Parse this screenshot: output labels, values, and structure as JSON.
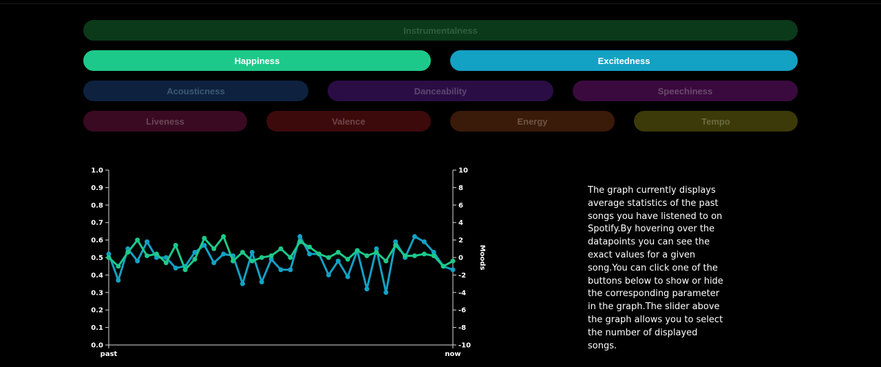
{
  "buttons": {
    "instrumentalness": {
      "label": "Instrumentalness",
      "bg": "#0a3a1a",
      "fg": "#2f5f3d"
    },
    "happiness": {
      "label": "Happiness",
      "bg": "#1dc98a",
      "fg": "#ffffff"
    },
    "excitedness": {
      "label": "Excitedness",
      "bg": "#13a1c4",
      "fg": "#ffffff"
    },
    "acousticness": {
      "label": "Acousticness",
      "bg": "#0e2240",
      "fg": "#3d5772"
    },
    "danceability": {
      "label": "Danceability",
      "bg": "#2a0d44",
      "fg": "#5c4873"
    },
    "speechiness": {
      "label": "Speechiness",
      "bg": "#3a0a3e",
      "fg": "#6a4a6c"
    },
    "liveness": {
      "label": "Liveness",
      "bg": "#3a0a22",
      "fg": "#6b4756"
    },
    "valence": {
      "label": "Valence",
      "bg": "#3d0a0c",
      "fg": "#704547"
    },
    "energy": {
      "label": "Energy",
      "bg": "#3a1a08",
      "fg": "#6f5545"
    },
    "tempo": {
      "label": "Tempo",
      "bg": "#3c3a08",
      "fg": "#6b6a42"
    }
  },
  "chart_data": {
    "type": "line",
    "x_start_label": "past",
    "x_end_label": "now",
    "y_left_ticks": [
      "0.0",
      "0.1",
      "0.2",
      "0.3",
      "0.4",
      "0.5",
      "0.6",
      "0.7",
      "0.8",
      "0.9",
      "1.0"
    ],
    "y_right_ticks": [
      "-10",
      "-8",
      "-6",
      "-4",
      "-2",
      "0",
      "2",
      "4",
      "6",
      "8",
      "10"
    ],
    "y_right_label": "Moods",
    "ylim_left": [
      0,
      1
    ],
    "ylim_right": [
      -10,
      10
    ],
    "series": [
      {
        "color": "#13a1c4",
        "axis": "left",
        "values": [
          0.52,
          0.37,
          0.55,
          0.48,
          0.59,
          0.5,
          0.5,
          0.44,
          0.45,
          0.53,
          0.57,
          0.47,
          0.52,
          0.51,
          0.35,
          0.53,
          0.36,
          0.49,
          0.43,
          0.43,
          0.62,
          0.52,
          0.52,
          0.4,
          0.48,
          0.39,
          0.54,
          0.32,
          0.55,
          0.3,
          0.59,
          0.5,
          0.62,
          0.59,
          0.53,
          0.45,
          0.43
        ]
      },
      {
        "color": "#1dc98a",
        "axis": "left",
        "values": [
          0.5,
          0.45,
          0.53,
          0.6,
          0.51,
          0.52,
          0.47,
          0.57,
          0.43,
          0.49,
          0.61,
          0.55,
          0.62,
          0.48,
          0.53,
          0.48,
          0.5,
          0.51,
          0.55,
          0.5,
          0.59,
          0.56,
          0.52,
          0.5,
          0.53,
          0.49,
          0.54,
          0.51,
          0.53,
          0.48,
          0.57,
          0.51,
          0.51,
          0.52,
          0.51,
          0.45,
          0.48
        ]
      }
    ]
  },
  "description": "The graph currently displays average statistics of the past songs you have listened to on Spotify.By hovering over the datapoints you can see the exact values for a given song.You can click one of the buttons below to show or hide the corresponding parameter in the graph.The slider above the graph allows you to select the number of displayed songs."
}
